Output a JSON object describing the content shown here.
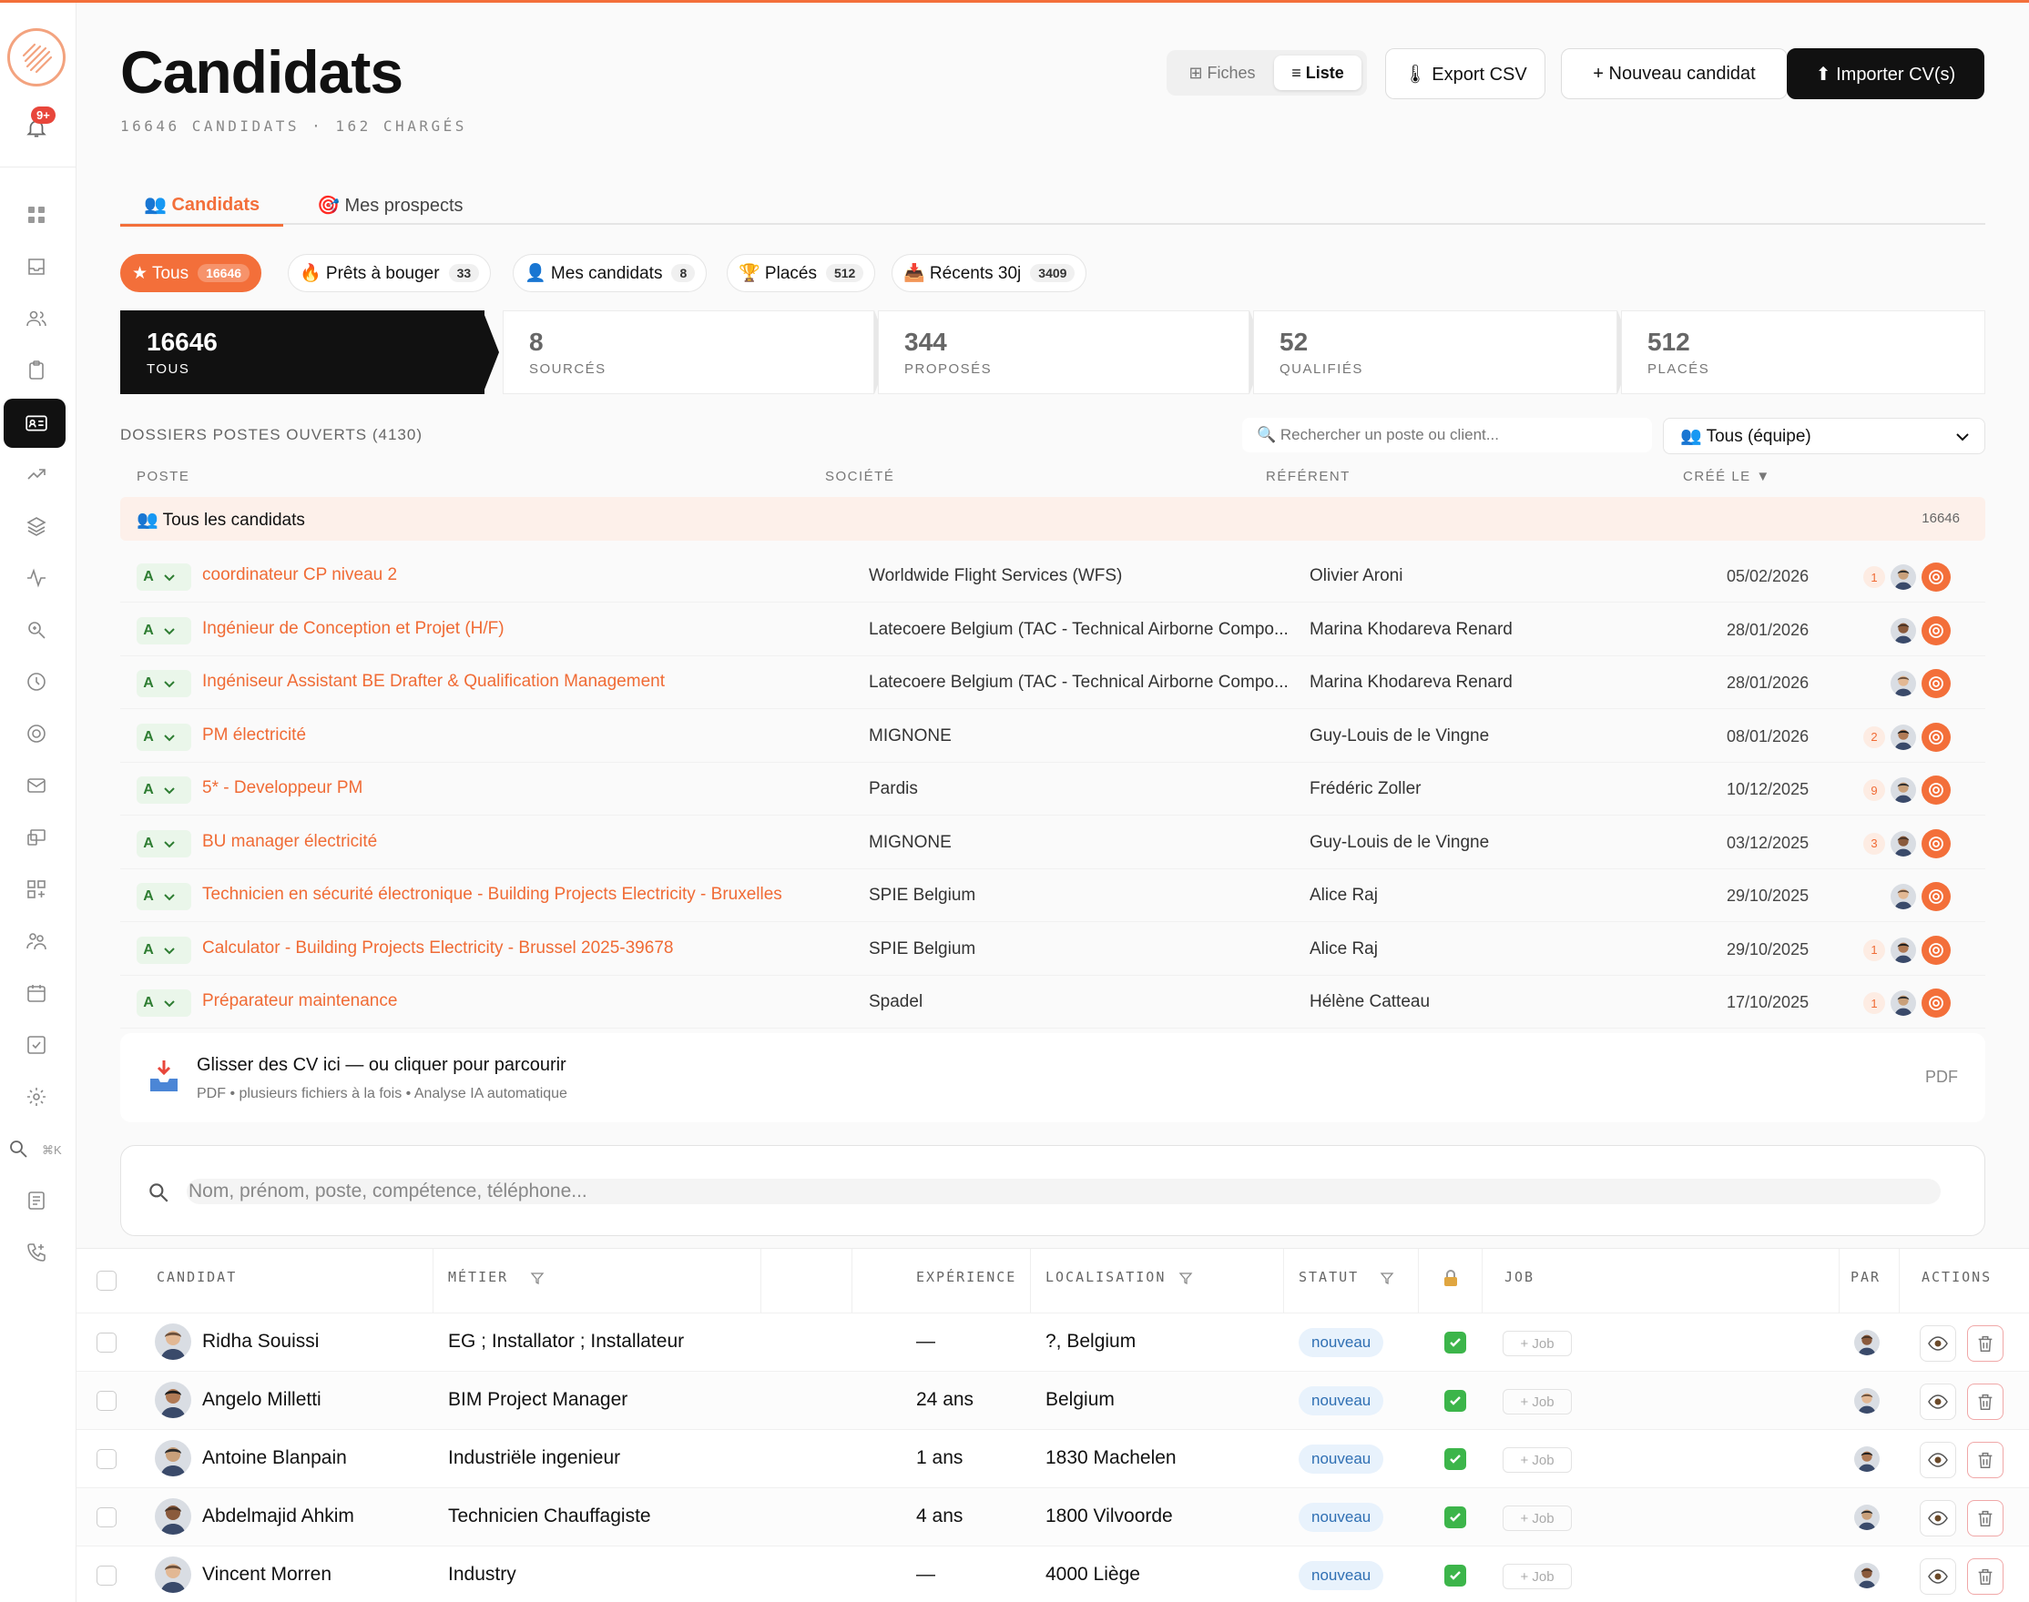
{
  "colors": {
    "accent": "#f36f3a",
    "dark": "#111111",
    "status_blue": "#2f6fb3",
    "check_green": "#3cb54a"
  },
  "sidebar": {
    "notification_badge": "9+",
    "search_shortcut": "⌘K",
    "icons": [
      "dashboard-icon",
      "inbox-icon",
      "users-icon",
      "clipboard-icon",
      "id-card-icon",
      "trending-icon",
      "layers-icon",
      "activity-icon",
      "search-zoom-icon",
      "history-icon",
      "target-icon",
      "mail-icon",
      "devices-icon",
      "apps-add-icon",
      "team-icon",
      "calendar-icon",
      "checkbox-icon",
      "settings-icon",
      "search-icon",
      "notes-icon",
      "phone-add-icon"
    ]
  },
  "header": {
    "title": "Candidats",
    "subtitle": "16646 CANDIDATS · 162 CHARGÉS",
    "view_fiches": "⊞ Fiches",
    "view_liste": "≡ Liste",
    "export_label": "🌡 Export CSV",
    "new_label": "+ Nouveau candidat",
    "import_label": "⬆ Importer CV(s)"
  },
  "tabs": [
    {
      "label": "👥 Candidats"
    },
    {
      "label": "🎯 Mes prospects"
    }
  ],
  "filters": [
    {
      "label": "★ Tous",
      "count": "16646"
    },
    {
      "label": "🔥 Prêts à bouger",
      "count": "33"
    },
    {
      "label": "👤 Mes candidats",
      "count": "8"
    },
    {
      "label": "🏆 Placés",
      "count": "512"
    },
    {
      "label": "📥 Récents 30j",
      "count": "3409"
    }
  ],
  "funnel": [
    {
      "num": "16646",
      "label": "TOUS"
    },
    {
      "num": "8",
      "label": "SOURCÉS"
    },
    {
      "num": "344",
      "label": "PROPOSÉS"
    },
    {
      "num": "52",
      "label": "QUALIFIÉS"
    },
    {
      "num": "512",
      "label": "PLACÉS"
    }
  ],
  "dossiers": {
    "title": "DOSSIERS POSTES OUVERTS (4130)",
    "search_placeholder": "🔍 Rechercher un poste ou client...",
    "team_select": "👥 Tous (équipe)",
    "headers": {
      "poste": "POSTE",
      "societe": "SOCIÉTÉ",
      "referent": "RÉFÉRENT",
      "cree": "CRÉÉ LE ▼"
    },
    "all_label": "👥 Tous les candidats",
    "all_count": "16646",
    "rows": [
      {
        "grade": "A",
        "poste": "coordinateur CP niveau 2",
        "societe": "Worldwide Flight Services (WFS)",
        "referent": "Olivier Aroni",
        "date": "05/02/2026",
        "count": "1"
      },
      {
        "grade": "A",
        "poste": "Ingénieur de Conception et Projet (H/F)",
        "societe": "Latecoere Belgium (TAC - Technical Airborne Compo...",
        "referent": "Marina Khodareva Renard",
        "date": "28/01/2026",
        "count": ""
      },
      {
        "grade": "A",
        "poste": "Ingéniseur Assistant BE Drafter & Qualification Management",
        "societe": "Latecoere Belgium (TAC - Technical Airborne Compo...",
        "referent": "Marina Khodareva Renard",
        "date": "28/01/2026",
        "count": ""
      },
      {
        "grade": "A",
        "poste": "PM électricité",
        "societe": "MIGNONE",
        "referent": "Guy-Louis de le Vingne",
        "date": "08/01/2026",
        "count": "2"
      },
      {
        "grade": "A",
        "poste": "5* - Developpeur PM",
        "societe": "Pardis",
        "referent": "Frédéric Zoller",
        "date": "10/12/2025",
        "count": "9"
      },
      {
        "grade": "A",
        "poste": "BU manager électricité",
        "societe": "MIGNONE",
        "referent": "Guy-Louis de le Vingne",
        "date": "03/12/2025",
        "count": "3"
      },
      {
        "grade": "A",
        "poste": "Technicien en sécurité électronique - Building Projects Electricity - Bruxelles",
        "societe": "SPIE Belgium",
        "referent": "Alice Raj",
        "date": "29/10/2025",
        "count": ""
      },
      {
        "grade": "A",
        "poste": "Calculator - Building Projects Electricity - Brussel 2025-39678",
        "societe": "SPIE Belgium",
        "referent": "Alice Raj",
        "date": "29/10/2025",
        "count": "1"
      },
      {
        "grade": "A",
        "poste": "Préparateur maintenance",
        "societe": "Spadel",
        "referent": "Hélène Catteau",
        "date": "17/10/2025",
        "count": "1"
      }
    ]
  },
  "dropzone": {
    "title": "Glisser des CV ici — ou cliquer pour parcourir",
    "hint": "PDF • plusieurs fichiers à la fois • Analyse IA automatique",
    "format": "PDF"
  },
  "search": {
    "placeholder": "Nom, prénom, poste, compétence, téléphone..."
  },
  "grid": {
    "headers": {
      "candidat": "CANDIDAT",
      "metier": "MÉTIER",
      "experience": "EXPÉRIENCE",
      "localisation": "LOCALISATION",
      "statut": "STATUT",
      "job": "JOB",
      "par": "PAR",
      "actions": "ACTIONS"
    },
    "job_label": "+ Job",
    "rows": [
      {
        "name": "Ridha Souissi",
        "metier": "EG ; Installator ; Installateur",
        "experience": "—",
        "localisation": "?, Belgium",
        "statut": "nouveau"
      },
      {
        "name": "Angelo Milletti",
        "metier": "BIM Project Manager",
        "experience": "24 ans",
        "localisation": "Belgium",
        "statut": "nouveau"
      },
      {
        "name": "Antoine Blanpain",
        "metier": "Industriële ingenieur",
        "experience": "1 ans",
        "localisation": "1830 Machelen",
        "statut": "nouveau"
      },
      {
        "name": "Abdelmajid Ahkim",
        "metier": "Technicien Chauffagiste",
        "experience": "4 ans",
        "localisation": "1800 Vilvoorde",
        "statut": "nouveau"
      },
      {
        "name": "Vincent Morren",
        "metier": "Industry",
        "experience": "—",
        "localisation": "4000 Liège",
        "statut": "nouveau"
      }
    ]
  }
}
